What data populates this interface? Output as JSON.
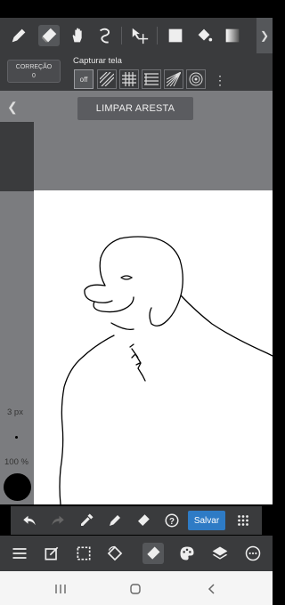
{
  "snap_bar": {
    "correction_title": "CORREÇÃO",
    "correction_value": "0",
    "snap_label": "Capturar tela",
    "snap_off": "off"
  },
  "edge_panel": {
    "clear_edge_label": "LIMPAR ARESTA"
  },
  "brush": {
    "size_label": "3 px",
    "opacity_label": "100 %",
    "color": "#000000"
  },
  "quick_bar": {
    "save_label": "Salvar",
    "accent": "#2e7bc5"
  },
  "tools": [
    "pen-icon",
    "eraser-icon",
    "hand-icon",
    "lasso-icon",
    "move-icon",
    "fill-rect-icon",
    "bucket-icon",
    "gradient-icon"
  ],
  "bottom_tools": [
    "menu-icon",
    "edit-icon",
    "selection-icon",
    "rotate-icon",
    "eraser-icon",
    "palette-icon",
    "layers-icon",
    "more-icon"
  ]
}
